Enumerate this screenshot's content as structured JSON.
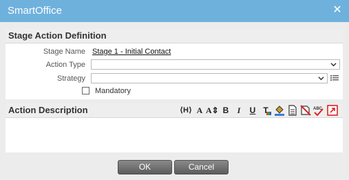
{
  "window": {
    "title": "SmartOffice"
  },
  "definition": {
    "section_title": "Stage Action Definition",
    "stage_name_label": "Stage Name",
    "stage_name_value": "Stage 1 - Initial Contact",
    "action_type_label": "Action Type",
    "action_type_value": "",
    "strategy_label": "Strategy",
    "strategy_value": "",
    "mandatory_label": "Mandatory",
    "mandatory_checked": false
  },
  "description": {
    "section_title": "Action Description",
    "toolbar": {
      "heading": "⟨H⟩",
      "font": "A",
      "size": "A",
      "bold": "B",
      "italic": "I",
      "underline": "U",
      "text_color": "T",
      "abc": "ABC"
    }
  },
  "buttons": {
    "ok": "OK",
    "cancel": "Cancel"
  },
  "colors": {
    "titlebar": "#6fb1dd",
    "button": "#6b6b6b"
  }
}
